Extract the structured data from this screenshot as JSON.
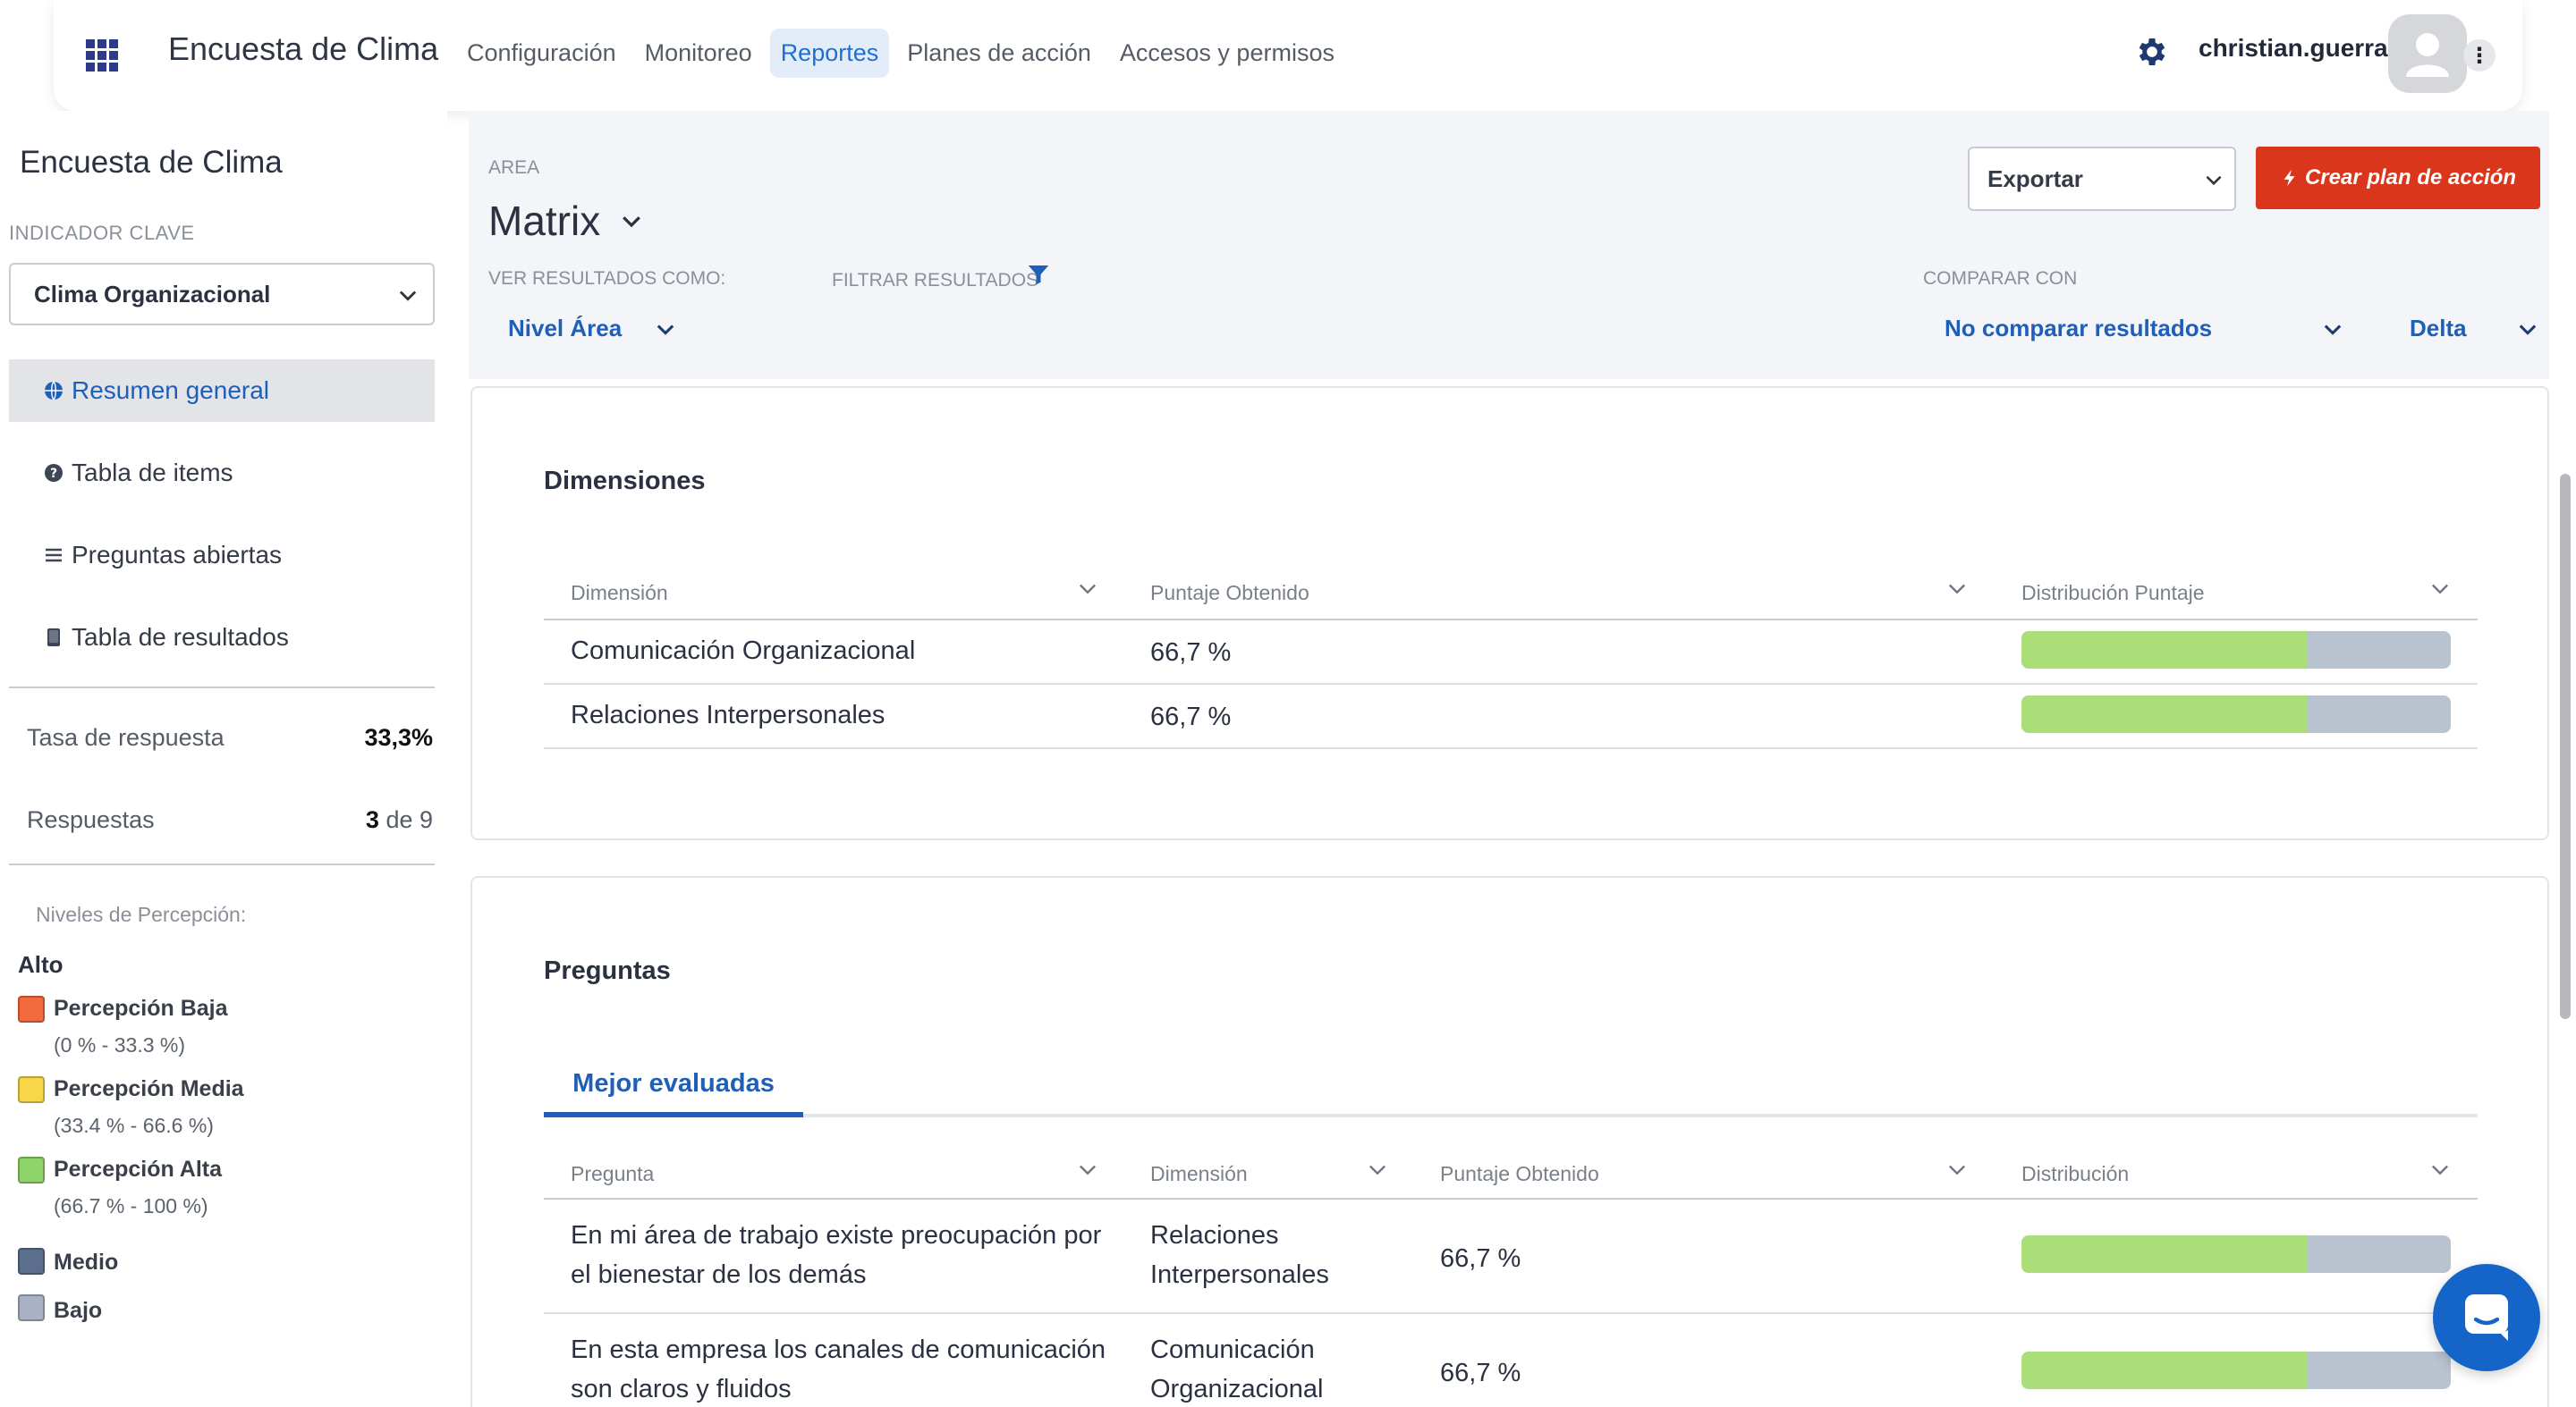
{
  "topbar": {
    "brand": "Encuesta de Clima",
    "nav": [
      {
        "label": "Configuración",
        "active": false
      },
      {
        "label": "Monitoreo",
        "active": false
      },
      {
        "label": "Reportes",
        "active": true
      },
      {
        "label": "Planes de acción",
        "active": false
      },
      {
        "label": "Accesos y permisos",
        "active": false
      }
    ],
    "username": "christian.guerra"
  },
  "sidebar": {
    "title": "Encuesta de Clima",
    "indicator_label": "INDICADOR CLAVE",
    "indicator_value": "Clima Organizacional",
    "items": [
      {
        "label": "Resumen general",
        "icon": "globe-icon",
        "active": true
      },
      {
        "label": "Tabla de items",
        "icon": "question-circle-icon",
        "active": false
      },
      {
        "label": "Preguntas abiertas",
        "icon": "list-icon",
        "active": false
      },
      {
        "label": "Tabla de resultados",
        "icon": "tablet-icon",
        "active": false
      }
    ],
    "response_rate": {
      "label": "Tasa de respuesta",
      "value": "33,3%"
    },
    "responses": {
      "label": "Respuestas",
      "count": "3",
      "of_text": "de 9"
    },
    "legend": {
      "title": "Niveles de Percepción:",
      "subtitle": "Alto",
      "levels": [
        {
          "name": "Percepción Baja",
          "range": "(0 % - 33.3 %)",
          "color": "#f26a3d"
        },
        {
          "name": "Percepción Media",
          "range": "(33.4 % - 66.6 %)",
          "color": "#f7d64a"
        },
        {
          "name": "Percepción Alta",
          "range": "(66.7 % - 100 %)",
          "color": "#8fd46a"
        },
        {
          "name": "Medio",
          "color": "#5b6f8c"
        },
        {
          "name": "Bajo",
          "color": "#a9b2c4"
        }
      ]
    }
  },
  "header": {
    "area_label": "AREA",
    "area_value": "Matrix",
    "view_as_label": "VER RESULTADOS COMO:",
    "view_as_value": "Nivel Área",
    "filter_label": "FILTRAR RESULTADOS",
    "compare_label": "COMPARAR CON",
    "compare_value": "No comparar resultados",
    "delta_label": "Delta",
    "export_label": "Exportar",
    "create_plan_label": "Crear plan de acción"
  },
  "dimensions": {
    "title": "Dimensiones",
    "columns": [
      "Dimensión",
      "Puntaje Obtenido",
      "Distribución Puntaje"
    ],
    "rows": [
      {
        "dimension": "Comunicación Organizacional",
        "score": "66,7 %",
        "distribution_high_fraction": 0.667
      },
      {
        "dimension": "Relaciones Interpersonales",
        "score": "66,7 %",
        "distribution_high_fraction": 0.667
      }
    ]
  },
  "questions": {
    "title": "Preguntas",
    "tab_label": "Mejor evaluadas",
    "columns": [
      "Pregunta",
      "Dimensión",
      "Puntaje Obtenido",
      "Distribución"
    ],
    "rows": [
      {
        "question": "En mi área de trabajo existe preocupación por el bienestar de los demás",
        "dimension": "Relaciones Interpersonales",
        "score": "66,7 %",
        "distribution_high_fraction": 0.667
      },
      {
        "question": "En esta empresa los canales de comunicación son claros y fluidos",
        "dimension": "Comunicación Organizacional",
        "score": "66,7 %",
        "distribution_high_fraction": 0.667
      }
    ]
  },
  "colors": {
    "accent": "#1f5fb8",
    "primary_button": "#d9361c",
    "bar_high": "#abdd79",
    "bar_rest": "#b9c3d0"
  }
}
